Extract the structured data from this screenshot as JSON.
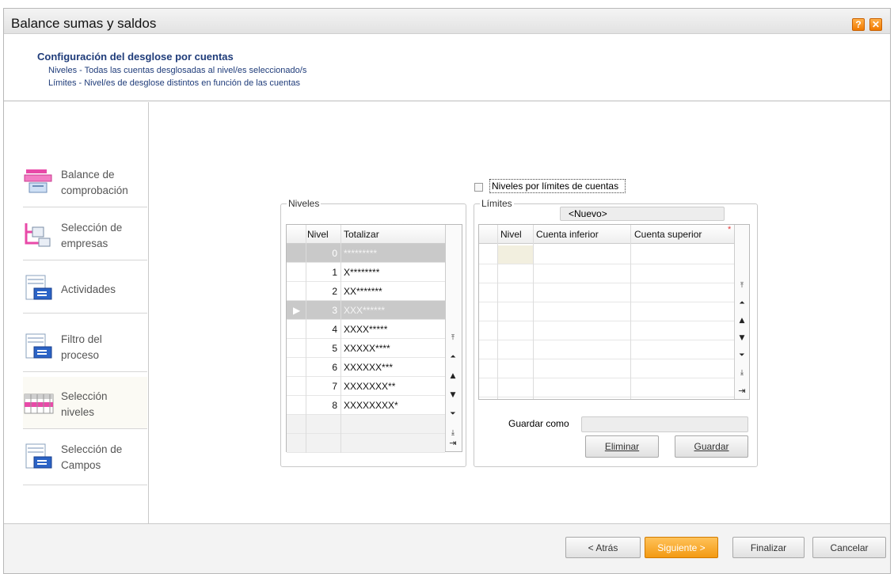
{
  "window": {
    "title": "Balance sumas y saldos",
    "help_label": "?",
    "close_label": "✕"
  },
  "header": {
    "title": "Configuración del desglose por cuentas",
    "line1": "Niveles - Todas las cuentas desglosadas al nivel/es seleccionado/s",
    "line2": "Límites - Nivel/es de desglose distintos en función de las cuentas"
  },
  "sidebar": {
    "items": [
      {
        "line1": "Balance de",
        "line2": "comprobación",
        "icon": "balance-icon"
      },
      {
        "line1": "Selección de",
        "line2": "empresas",
        "icon": "companies-icon"
      },
      {
        "line1": "Actividades",
        "line2": "",
        "icon": "activities-icon"
      },
      {
        "line1": "Filtro del",
        "line2": "proceso",
        "icon": "filter-icon"
      },
      {
        "line1": "Selección",
        "line2": "niveles",
        "icon": "levels-icon"
      },
      {
        "line1": "Selección de",
        "line2": "Campos",
        "icon": "fields-icon"
      }
    ]
  },
  "niveles": {
    "group_label": "Niveles",
    "col_nivel": "Nivel",
    "col_totalizar": "Totalizar",
    "rows": [
      {
        "nivel": "0",
        "totalizar": "*********"
      },
      {
        "nivel": "1",
        "totalizar": "X********"
      },
      {
        "nivel": "2",
        "totalizar": "XX*******"
      },
      {
        "nivel": "3",
        "totalizar": "XXX******"
      },
      {
        "nivel": "4",
        "totalizar": "XXXX*****"
      },
      {
        "nivel": "5",
        "totalizar": "XXXXX****"
      },
      {
        "nivel": "6",
        "totalizar": "XXXXXX***"
      },
      {
        "nivel": "7",
        "totalizar": "XXXXXXX**"
      },
      {
        "nivel": "8",
        "totalizar": "XXXXXXXX*"
      }
    ]
  },
  "limites": {
    "checkbox_label": "Niveles por límites de cuentas",
    "group_label": "Límites",
    "combo_value": "<Nuevo>",
    "col_nivel": "Nivel",
    "col_inferior": "Cuenta inferior",
    "col_superior": "Cuenta superior",
    "required_mark": "*",
    "guardar_como_label": "Guardar como",
    "guardar_como_value": "",
    "eliminar_label": "Eliminar",
    "guardar_label": "Guardar"
  },
  "footer": {
    "atras": "< Atrás",
    "siguiente": "Siguiente >",
    "finalizar": "Finalizar",
    "cancelar": "Cancelar"
  },
  "colors": {
    "accent_orange": "#f39a13",
    "title_blue": "#1f3c7a",
    "selected_row": "#c9c9c9"
  }
}
